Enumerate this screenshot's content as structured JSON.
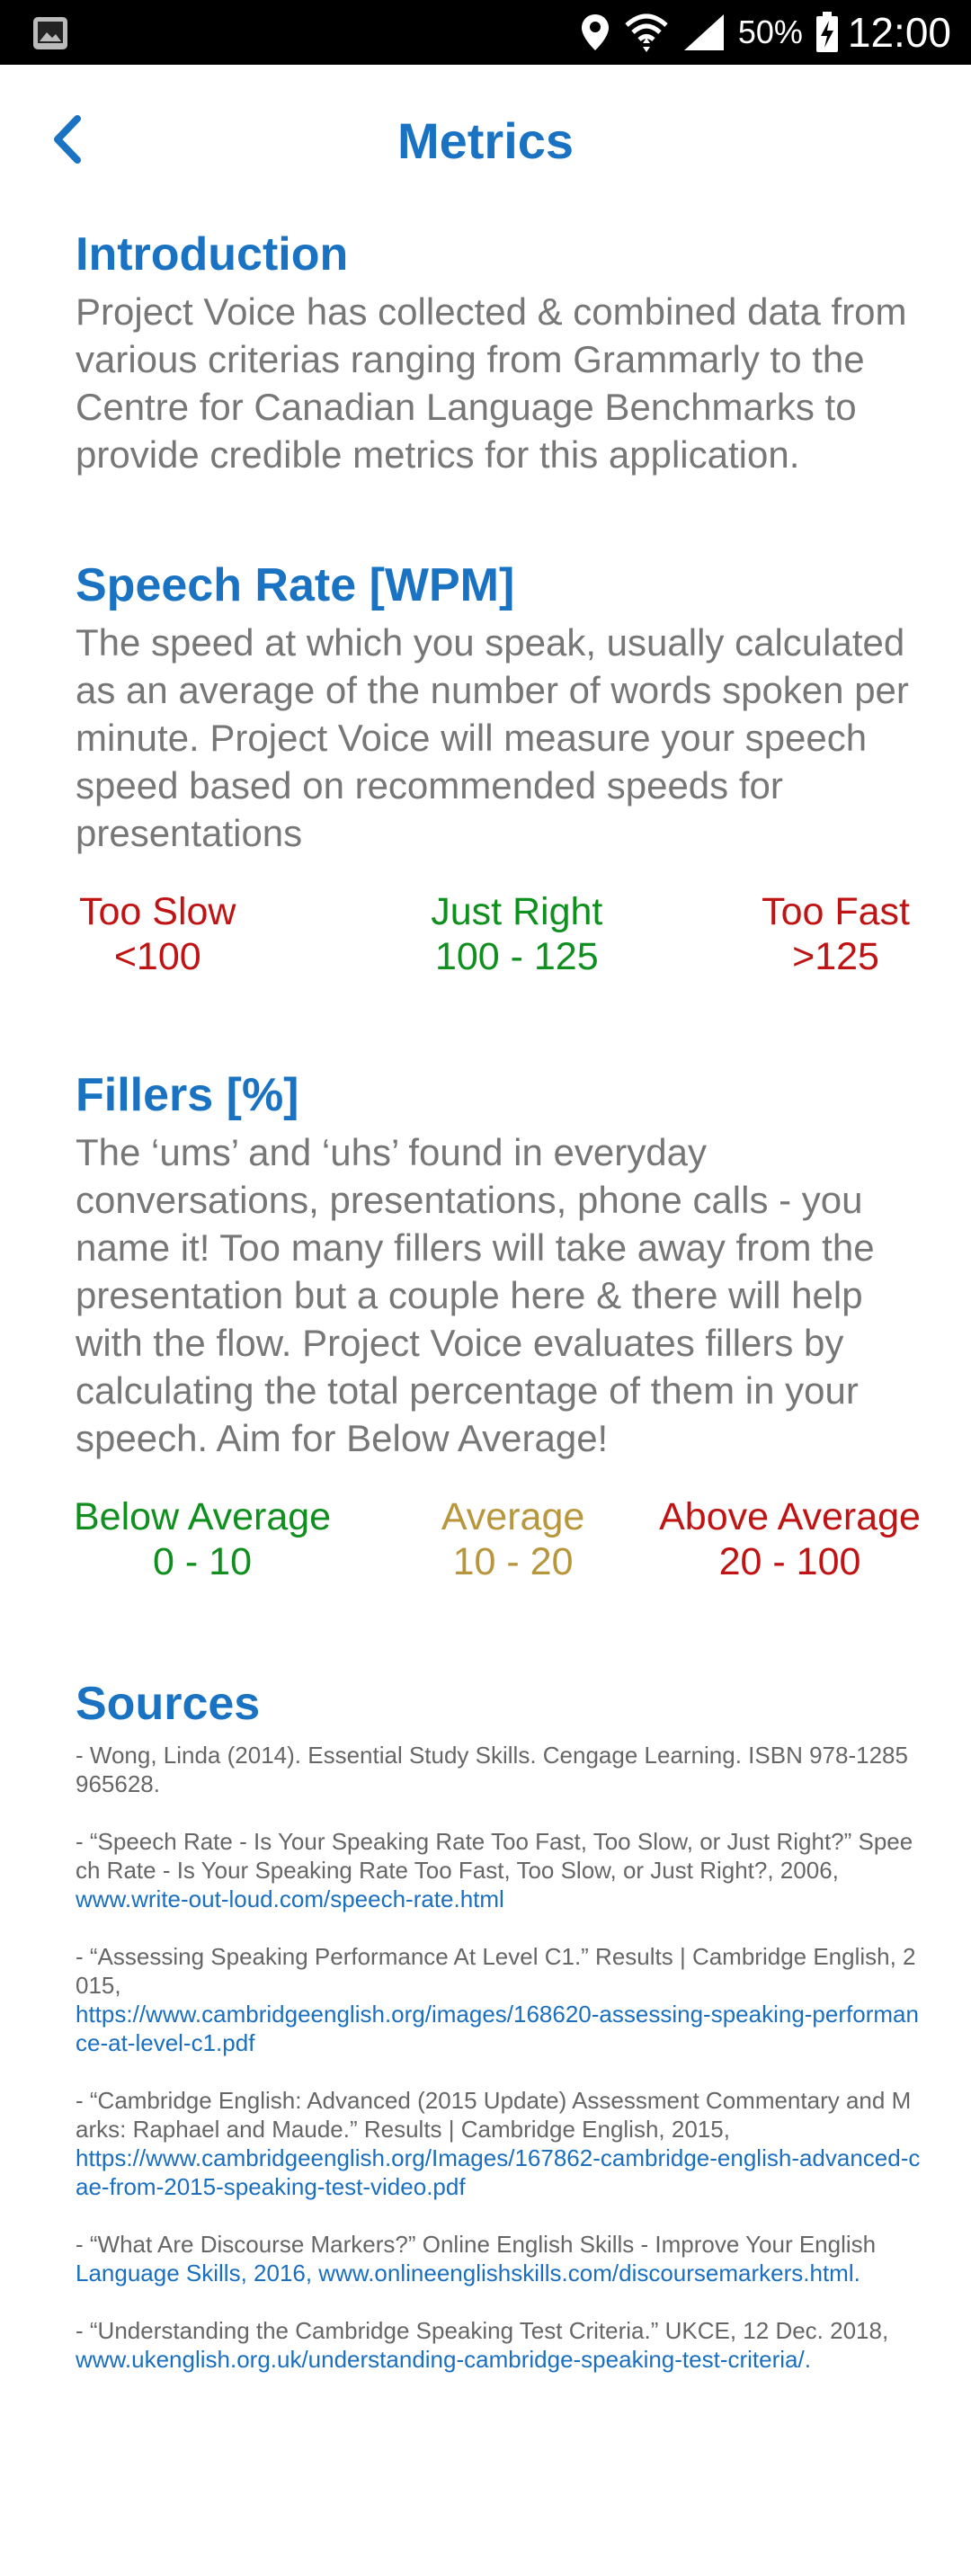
{
  "status_bar": {
    "battery": "50%",
    "time": "12:00"
  },
  "header": {
    "title": "Metrics"
  },
  "introduction": {
    "heading": "Introduction",
    "body": "Project Voice has collected & combined data from various criterias ranging from Grammarly to the Centre for Canadian Language Benchmarks to provide credible metrics for this application."
  },
  "speech_rate": {
    "heading": "Speech Rate [WPM]",
    "body": "The speed at which you speak, usually calculated as an average of the number of words spoken per minute. Project Voice will measure your speech speed based on recommended speeds for presentations",
    "ranges": [
      {
        "label": "Too Slow",
        "value": "<100",
        "color": "#c01414"
      },
      {
        "label": "Just Right",
        "value": "100 - 125",
        "color": "#0f8f1e"
      },
      {
        "label": "Too Fast",
        "value": ">125",
        "color": "#c01414"
      }
    ]
  },
  "fillers": {
    "heading": "Fillers [%]",
    "body": "The ‘ums’ and ‘uhs’ found in everyday conversations, presentations, phone calls - you name it! Too many fillers will take away from the presentation but a couple here & there will help with the flow. Project Voice evaluates fillers by calculating the total percentage of them in your speech.  Aim for Below Average!",
    "ranges": [
      {
        "label": "Below Average",
        "value": "0 - 10",
        "color": "#0f8f1e"
      },
      {
        "label": "Average",
        "value": "10 - 20",
        "color": "#b8963c"
      },
      {
        "label": "Above Average",
        "value": "20 - 100",
        "color": "#c01414"
      }
    ]
  },
  "sources": {
    "heading": "Sources",
    "items": [
      {
        "text": "- Wong, Linda (2014). Essential Study Skills. Cengage Learning. ISBN 978-1285965628.",
        "link": ""
      },
      {
        "text": "- “Speech Rate - Is Your Speaking Rate Too Fast, Too Slow, or Just Right?” Speech Rate - Is Your Speaking Rate Too Fast, Too Slow, or Just Right?, 2006,",
        "link": "www.write-out-loud.com/speech-rate.html"
      },
      {
        "text": "- “Assessing Speaking Performance At Level C1.” Results | Cambridge English, 2015,",
        "link": "https://www.cambridgeenglish.org/images/168620-assessing-speaking-performance-at-level-c1.pdf"
      },
      {
        "text": "- “Cambridge English: Advanced (2015 Update) Assessment Commentary and Marks: Raphael and Maude.” Results | Cambridge English, 2015,",
        "link": "https://www.cambridgeenglish.org/Images/167862-cambridge-english-advanced-cae-from-2015-speaking-test-video.pdf"
      },
      {
        "text": "- “What Are Discourse Markers?” Online English Skills - Improve Your English",
        "link": "Language Skills, 2016, www.onlineenglishskills.com/discoursemarkers.html."
      },
      {
        "text": "- “Understanding the Cambridge Speaking Test Criteria.” UKCE, 12 Dec. 2018,",
        "link": "www.ukenglish.org.uk/understanding-cambridge-speaking-test-criteria/."
      }
    ]
  }
}
